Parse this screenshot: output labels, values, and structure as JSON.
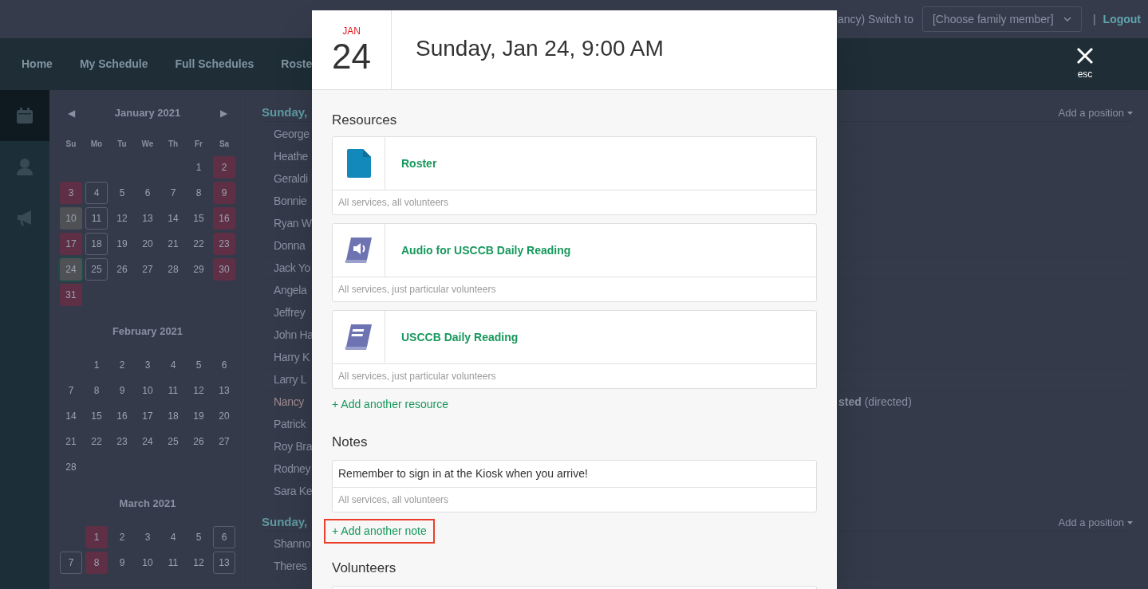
{
  "top_bar": {
    "user_text": "ancy) Switch to",
    "family_select": "[Choose family member]",
    "separator": "|",
    "logout": "Logout"
  },
  "nav": [
    {
      "label": "Home"
    },
    {
      "label": "My Schedule"
    },
    {
      "label": "Full Schedules"
    },
    {
      "label": "Roste"
    }
  ],
  "sidebar": [
    {
      "kind": "calendar",
      "selected": true
    },
    {
      "kind": "person",
      "selected": false
    },
    {
      "kind": "megaphone",
      "selected": false
    }
  ],
  "calendars": [
    {
      "title": "January 2021",
      "prev": "◀",
      "next": "▶",
      "weekdays": [
        "Su",
        "Mo",
        "Tu",
        "We",
        "Th",
        "Fr",
        "Sa"
      ],
      "weeks": [
        [
          {
            "kind": "blank"
          },
          {
            "kind": "blank"
          },
          {
            "kind": "blank"
          },
          {
            "kind": "blank"
          },
          {
            "kind": "blank"
          },
          {
            "day": "1",
            "kind": "plain",
            "selected": false
          },
          {
            "day": "2",
            "kind": "filled",
            "selected": false
          }
        ],
        [
          {
            "day": "3",
            "kind": "filled",
            "selected": false
          },
          {
            "day": "4",
            "kind": "outlined",
            "selected": false
          },
          {
            "day": "5",
            "kind": "plain",
            "selected": false
          },
          {
            "day": "6",
            "kind": "plain",
            "selected": false
          },
          {
            "day": "7",
            "kind": "plain",
            "selected": false
          },
          {
            "day": "8",
            "kind": "plain",
            "selected": false
          },
          {
            "day": "9",
            "kind": "filled",
            "selected": false
          }
        ],
        [
          {
            "day": "10",
            "kind": "shaded",
            "selected": false
          },
          {
            "day": "11",
            "kind": "outlined",
            "selected": false
          },
          {
            "day": "12",
            "kind": "plain",
            "selected": false
          },
          {
            "day": "13",
            "kind": "plain",
            "selected": false
          },
          {
            "day": "14",
            "kind": "plain",
            "selected": false
          },
          {
            "day": "15",
            "kind": "plain",
            "selected": false
          },
          {
            "day": "16",
            "kind": "filled",
            "selected": false
          }
        ],
        [
          {
            "day": "17",
            "kind": "filled",
            "selected": false
          },
          {
            "day": "18",
            "kind": "outlined",
            "selected": false
          },
          {
            "day": "19",
            "kind": "plain",
            "selected": false
          },
          {
            "day": "20",
            "kind": "plain",
            "selected": false
          },
          {
            "day": "21",
            "kind": "plain",
            "selected": false
          },
          {
            "day": "22",
            "kind": "plain",
            "selected": false
          },
          {
            "day": "23",
            "kind": "filled",
            "selected": false
          }
        ],
        [
          {
            "day": "24",
            "kind": "shaded",
            "selected": true
          },
          {
            "day": "25",
            "kind": "outlined",
            "selected": false
          },
          {
            "day": "26",
            "kind": "plain",
            "selected": false
          },
          {
            "day": "27",
            "kind": "plain",
            "selected": false
          },
          {
            "day": "28",
            "kind": "plain",
            "selected": false
          },
          {
            "day": "29",
            "kind": "plain",
            "selected": false
          },
          {
            "day": "30",
            "kind": "filled",
            "selected": false
          }
        ],
        [
          {
            "day": "31",
            "kind": "filled",
            "selected": false
          }
        ]
      ]
    },
    {
      "title": "February 2021",
      "weeks": [
        [
          {
            "kind": "blank"
          },
          {
            "day": "1",
            "kind": "plain",
            "selected": false
          },
          {
            "day": "2",
            "kind": "plain",
            "selected": false
          },
          {
            "day": "3",
            "kind": "plain",
            "selected": false
          },
          {
            "day": "4",
            "kind": "plain",
            "selected": false
          },
          {
            "day": "5",
            "kind": "plain",
            "selected": false
          },
          {
            "day": "6",
            "kind": "plain",
            "selected": false
          }
        ],
        [
          {
            "day": "7",
            "kind": "plain",
            "selected": false
          },
          {
            "day": "8",
            "kind": "plain",
            "selected": false
          },
          {
            "day": "9",
            "kind": "plain",
            "selected": false
          },
          {
            "day": "10",
            "kind": "plain",
            "selected": false
          },
          {
            "day": "11",
            "kind": "plain",
            "selected": false
          },
          {
            "day": "12",
            "kind": "plain",
            "selected": false
          },
          {
            "day": "13",
            "kind": "plain",
            "selected": false
          }
        ],
        [
          {
            "day": "14",
            "kind": "plain",
            "selected": false
          },
          {
            "day": "15",
            "kind": "plain",
            "selected": false
          },
          {
            "day": "16",
            "kind": "plain",
            "selected": false
          },
          {
            "day": "17",
            "kind": "plain",
            "selected": false
          },
          {
            "day": "18",
            "kind": "plain",
            "selected": false
          },
          {
            "day": "19",
            "kind": "plain",
            "selected": false
          },
          {
            "day": "20",
            "kind": "plain",
            "selected": false
          }
        ],
        [
          {
            "day": "21",
            "kind": "plain",
            "selected": false
          },
          {
            "day": "22",
            "kind": "plain",
            "selected": false
          },
          {
            "day": "23",
            "kind": "plain",
            "selected": false
          },
          {
            "day": "24",
            "kind": "plain",
            "selected": false
          },
          {
            "day": "25",
            "kind": "plain",
            "selected": false
          },
          {
            "day": "26",
            "kind": "plain",
            "selected": false
          },
          {
            "day": "27",
            "kind": "plain",
            "selected": false
          }
        ],
        [
          {
            "day": "28",
            "kind": "plain",
            "selected": false
          }
        ]
      ]
    },
    {
      "title": "March 2021",
      "weeks": [
        [
          {
            "kind": "blank"
          },
          {
            "day": "1",
            "kind": "filled",
            "selected": false
          },
          {
            "day": "2",
            "kind": "plain",
            "selected": false
          },
          {
            "day": "3",
            "kind": "plain",
            "selected": false
          },
          {
            "day": "4",
            "kind": "plain",
            "selected": false
          },
          {
            "day": "5",
            "kind": "plain",
            "selected": false
          },
          {
            "day": "6",
            "kind": "outlined",
            "selected": false
          }
        ],
        [
          {
            "day": "7",
            "kind": "outlined",
            "selected": false
          },
          {
            "day": "8",
            "kind": "filled",
            "selected": false
          },
          {
            "day": "9",
            "kind": "plain",
            "selected": false
          },
          {
            "day": "10",
            "kind": "plain",
            "selected": false
          },
          {
            "day": "11",
            "kind": "plain",
            "selected": false
          },
          {
            "day": "12",
            "kind": "plain",
            "selected": false
          },
          {
            "day": "13",
            "kind": "outlined",
            "selected": false
          }
        ]
      ]
    }
  ],
  "schedule": [
    {
      "heading": "Sunday,",
      "add_position": "Add a position",
      "rows": [
        {
          "name": "George",
          "highlighted": false
        },
        {
          "name": "Heathe",
          "highlighted": false
        },
        {
          "name": "Geraldi",
          "highlighted": false
        },
        {
          "name": "Bonnie",
          "highlighted": false
        },
        {
          "name": "Ryan W",
          "highlighted": false
        },
        {
          "name": "Donna",
          "highlighted": false
        },
        {
          "name": "Jack Yo",
          "highlighted": false
        },
        {
          "name": "Angela",
          "highlighted": false
        },
        {
          "name": "Jeffrey",
          "highlighted": false
        },
        {
          "name": "John Ha",
          "highlighted": false
        },
        {
          "name": "Harry K",
          "highlighted": false
        },
        {
          "name": "Larry L",
          "highlighted": false
        },
        {
          "name": "Nancy",
          "highlighted": true,
          "status": "**sted** (directed)"
        },
        {
          "name": "Patrick",
          "highlighted": false
        },
        {
          "name": "Roy Bra",
          "highlighted": false
        },
        {
          "name": "Rodney",
          "highlighted": false
        },
        {
          "name": "Sara Ke",
          "highlighted": false
        }
      ]
    },
    {
      "heading": "Sunday,",
      "add_position": "Add a position",
      "rows": [
        {
          "name": "Shanno",
          "highlighted": false
        },
        {
          "name": "Theres",
          "highlighted": false
        }
      ]
    }
  ],
  "modal": {
    "month": "JAN",
    "day": "24",
    "title": "Sunday, Jan 24, 9:00 AM",
    "close_label": "esc",
    "resources_heading": "Resources",
    "resources": [
      {
        "kind": "document",
        "name": "Roster",
        "scope": "All services, all volunteers"
      },
      {
        "kind": "audio-book",
        "name": "Audio for USCCB Daily Reading",
        "scope": "All services, just particular volunteers"
      },
      {
        "kind": "book",
        "name": "USCCB Daily Reading",
        "scope": "All services, just particular volunteers"
      }
    ],
    "add_resource": {
      "label": "+ Add another resource",
      "highlighted": false
    },
    "notes_heading": "Notes",
    "notes": [
      {
        "text": "Remember to sign in at the Kiosk when you arrive!",
        "scope": "All services, all volunteers"
      }
    ],
    "add_note": {
      "label": "+ Add another note",
      "highlighted": true
    },
    "volunteers_heading": "Volunteers"
  }
}
